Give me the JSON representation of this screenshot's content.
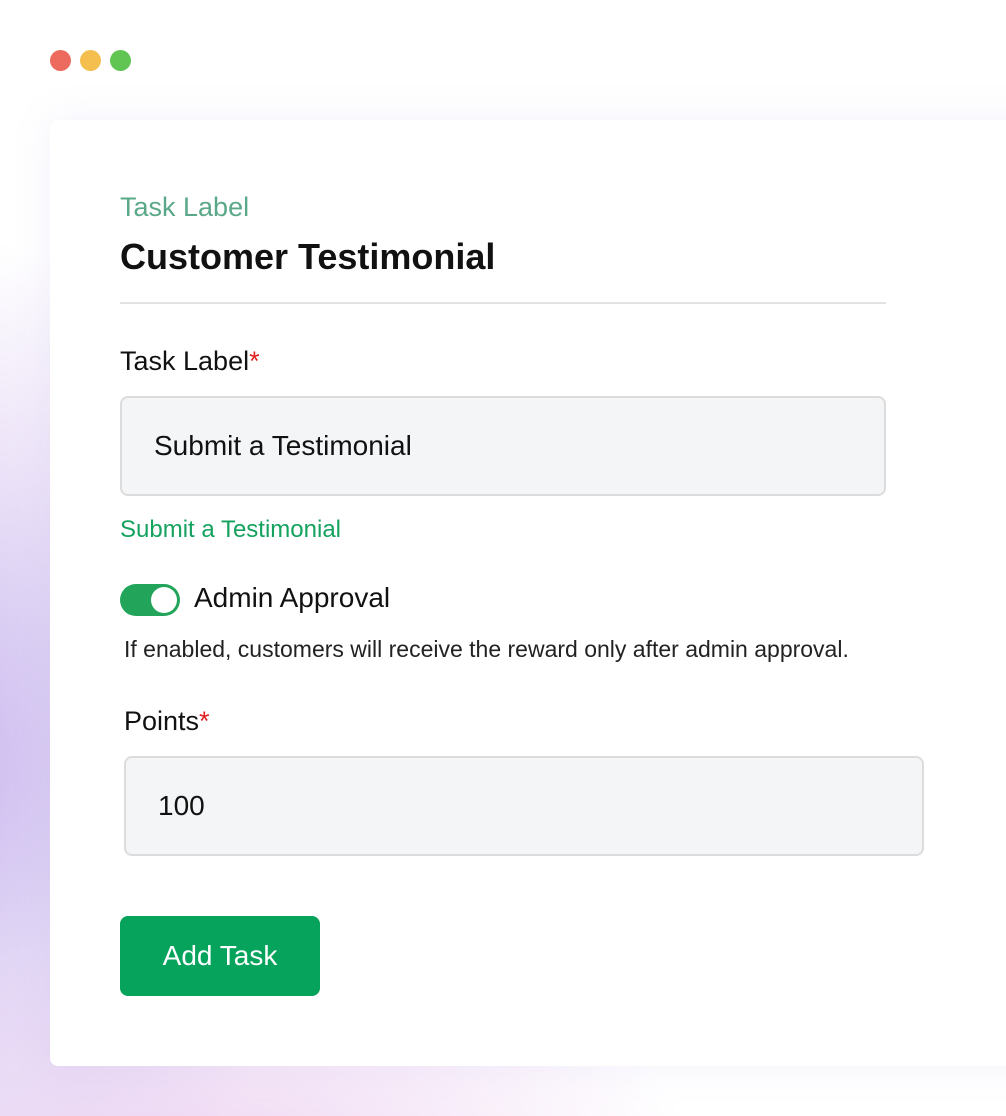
{
  "form": {
    "eyebrow": "Task Label",
    "title": "Customer Testimonial",
    "task_label": {
      "label": "Task Label",
      "required_mark": "*",
      "value": "Submit a Testimonial",
      "preview": "Submit a Testimonial"
    },
    "admin_approval": {
      "label": "Admin Approval",
      "enabled": true,
      "description": "If enabled, customers will receive the reward only after admin approval."
    },
    "points": {
      "label": "Points",
      "required_mark": "*",
      "value": "100"
    },
    "submit_label": "Add Task"
  },
  "colors": {
    "accent_green": "#05a35b",
    "eyebrow_green": "#5aa888",
    "required_red": "#e02020"
  }
}
